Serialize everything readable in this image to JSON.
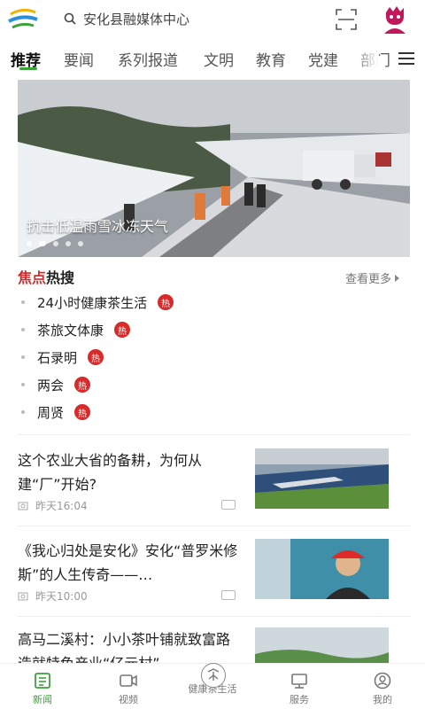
{
  "header": {
    "search_placeholder": "安化县融媒体中心",
    "logo_icon": "app-logo-icon",
    "scan_icon": "scan-icon",
    "avatar_icon": "mascot-avatar-icon"
  },
  "tabs": [
    {
      "label": "推荐",
      "active": true
    },
    {
      "label": "要闻"
    },
    {
      "label": "系列报道"
    },
    {
      "label": "文明"
    },
    {
      "label": "教育"
    },
    {
      "label": "党建"
    },
    {
      "label": "部门"
    }
  ],
  "banner": {
    "caption": "抗击低温雨雪冰冻天气"
  },
  "hot": {
    "title_red": "焦点",
    "title_black": "热搜",
    "see_more": "查看更多",
    "badge": "热",
    "items": [
      {
        "label": "24小时健康茶生活"
      },
      {
        "label": "茶旅文体康"
      },
      {
        "label": "石录明"
      },
      {
        "label": "两会"
      },
      {
        "label": "周贤"
      }
    ]
  },
  "news": [
    {
      "title": "这个农业大省的备耕，为何从建“厂”开始?",
      "time": "昨天16:04"
    },
    {
      "title": "《我心归处是安化》安化“普罗米修斯”的人生传奇——…",
      "time": "昨天10:00"
    },
    {
      "title": "高马二溪村：小小茶叶铺就致富路 造就特色产业“亿元村”",
      "time": ""
    }
  ],
  "bottom_nav": [
    {
      "label": "新闻",
      "active": true,
      "icon": "news-icon"
    },
    {
      "label": "视频",
      "icon": "video-icon"
    },
    {
      "label": "健康茶生活",
      "icon": "tea-icon"
    },
    {
      "label": "服务",
      "icon": "service-icon"
    },
    {
      "label": "我的",
      "icon": "profile-icon"
    }
  ],
  "colors": {
    "accent": "#3aa33a",
    "hot_red": "#d72a2a"
  }
}
